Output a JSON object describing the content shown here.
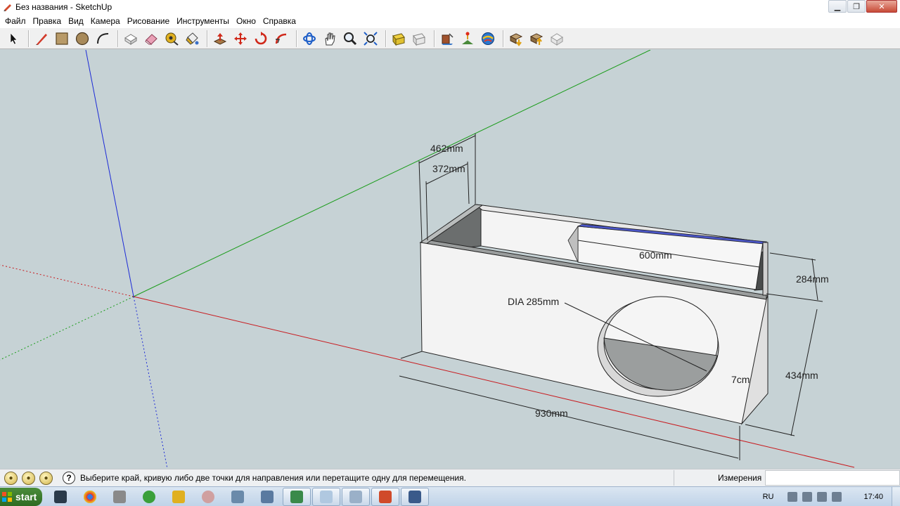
{
  "window": {
    "title": "Без названия - SketchUp",
    "min_glyph": "▁",
    "max_glyph": "❐",
    "close_glyph": "✕"
  },
  "menu": {
    "items": [
      "Файл",
      "Правка",
      "Вид",
      "Камера",
      "Рисование",
      "Инструменты",
      "Окно",
      "Справка"
    ]
  },
  "toolbar": {
    "tools": [
      {
        "name": "select-tool-icon"
      },
      {
        "name": "line-tool-icon"
      },
      {
        "name": "rectangle-tool-icon"
      },
      {
        "name": "circle-tool-icon"
      },
      {
        "name": "arc-tool-icon"
      },
      {
        "name": "make-component-icon"
      },
      {
        "name": "eraser-tool-icon"
      },
      {
        "name": "tape-measure-icon"
      },
      {
        "name": "paint-bucket-icon"
      },
      {
        "name": "push-pull-icon"
      },
      {
        "name": "move-tool-icon"
      },
      {
        "name": "rotate-tool-icon"
      },
      {
        "name": "follow-me-icon"
      },
      {
        "name": "orbit-tool-icon"
      },
      {
        "name": "pan-tool-icon"
      },
      {
        "name": "zoom-tool-icon"
      },
      {
        "name": "zoom-extents-icon"
      },
      {
        "name": "previous-view-icon"
      },
      {
        "name": "next-view-icon"
      },
      {
        "name": "add-location-icon"
      },
      {
        "name": "toggle-terrain-icon"
      },
      {
        "name": "get-models-icon"
      },
      {
        "name": "share-model-icon"
      },
      {
        "name": "share-component-icon"
      },
      {
        "name": "extension-warehouse-icon"
      }
    ]
  },
  "model": {
    "dimensions": {
      "depth_outer": "462mm",
      "depth_inner": "372mm",
      "inner_length": "600mm",
      "top_height": "284mm",
      "diameter": "DIA 285mm",
      "thickness": "7cm",
      "height": "434mm",
      "length": "930mm"
    },
    "colors": {
      "background": "#c6d2d5",
      "red_axis": "#c8191d",
      "green_axis": "#1a9c1a",
      "blue_axis": "#1c2ad6"
    }
  },
  "status": {
    "instruction": "Выберите край, кривую либо две точки для направления или перетащите одну для перемещения.",
    "measure_label": "Измерения",
    "measure_value": ""
  },
  "taskbar": {
    "start_label": "start",
    "lang": "RU",
    "time": "17:40"
  }
}
